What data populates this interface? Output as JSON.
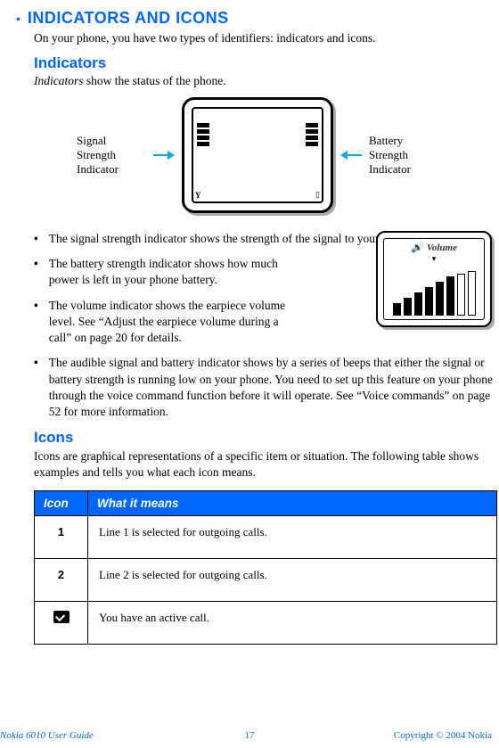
{
  "header": {
    "title": "INDICATORS AND ICONS",
    "intro": "On your phone, you have two types of identifiers: indicators and icons."
  },
  "indicators": {
    "heading": "Indicators",
    "subtext_prefix_italic": "Indicators",
    "subtext_rest": " show the status of the phone.",
    "figure": {
      "left_label_l1": "Signal",
      "left_label_l2": "Strength",
      "left_label_l3": "Indicator",
      "right_label_l1": "Battery",
      "right_label_l2": "Strength",
      "right_label_l3": "Indicator"
    },
    "bullets": [
      "The signal strength indicator shows the strength of the signal to your phone.",
      "The battery strength indicator shows how much power is left in your phone battery.",
      "The volume indicator shows the earpiece volume level. See “Adjust the earpiece volume during a call” on page 20 for details.",
      "The audible signal and battery indicator shows by a series of beeps that either the signal or battery strength is running low on your phone. You need to set up this feature on your phone through the voice command function before it will operate. See “Voice commands” on page 52 for more information."
    ],
    "volume_label": "Volume"
  },
  "icons": {
    "heading": "Icons",
    "desc": "Icons are graphical representations of a specific item or situation. The following table shows examples and tells you what each icon means.",
    "table": {
      "col1": "Icon",
      "col2": "What it means",
      "rows": [
        {
          "icon": "1",
          "meaning": "Line 1 is selected for outgoing calls."
        },
        {
          "icon": "2",
          "meaning": "Line 2 is selected for outgoing calls."
        },
        {
          "icon": "call",
          "meaning": "You have an active call."
        }
      ]
    }
  },
  "footer": {
    "guide": "Nokia 6010 User Guide",
    "page": "17",
    "copyright": "Copyright © 2004 Nokia"
  }
}
